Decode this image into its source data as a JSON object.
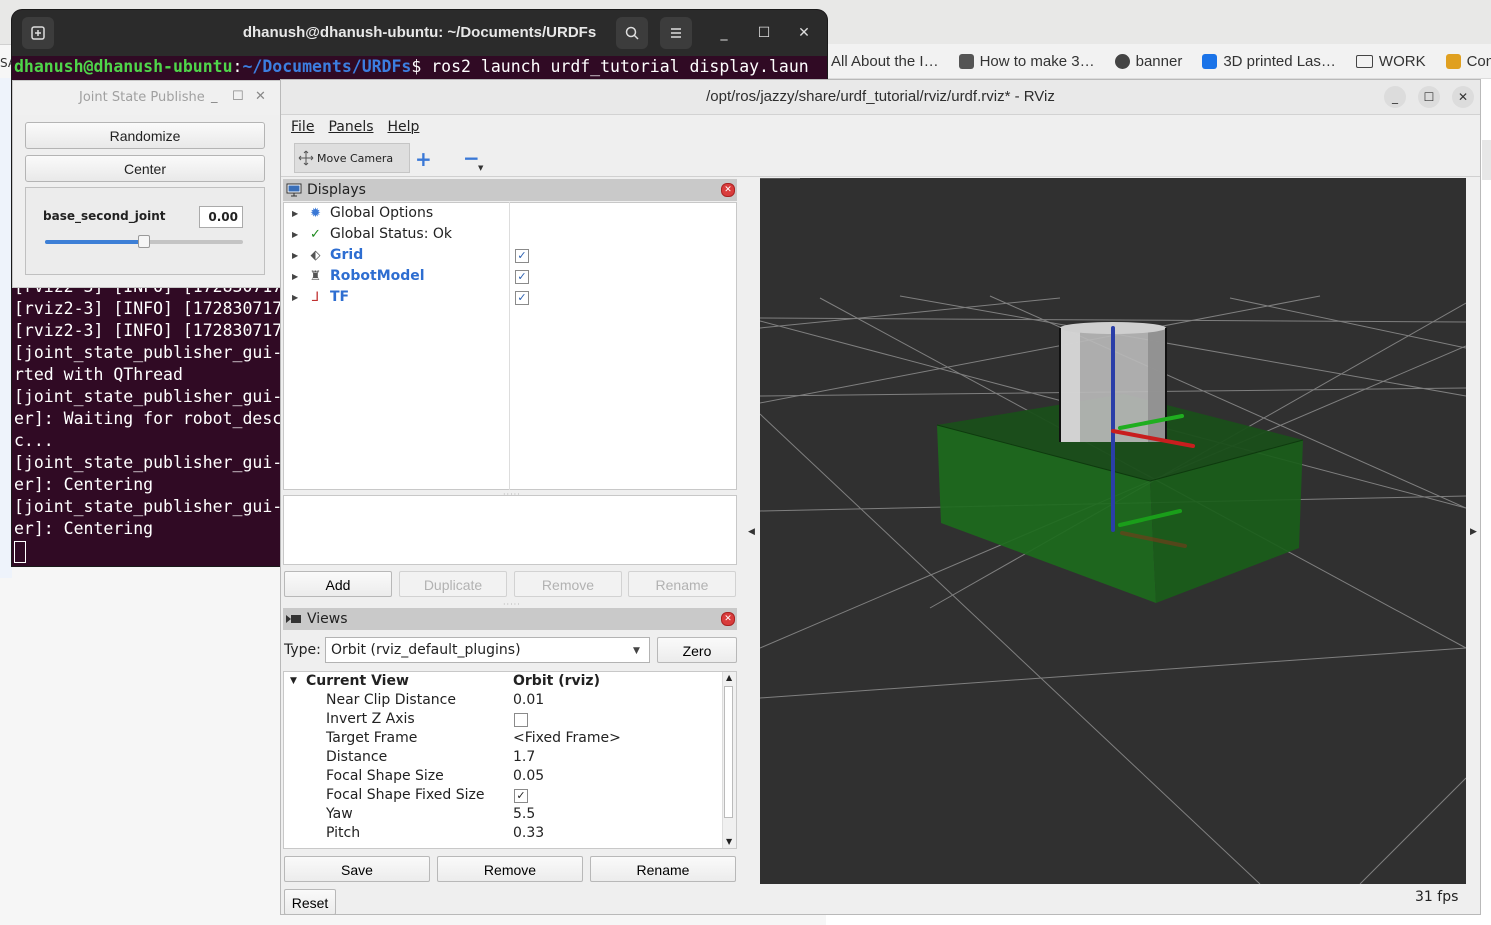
{
  "browser": {
    "bookmarks": [
      {
        "label": "All About the I…",
        "icon": "none",
        "color": ""
      },
      {
        "label": "How to make 3…",
        "icon": "site-icon",
        "color": "#555555"
      },
      {
        "label": "banner",
        "icon": "globe-icon",
        "color": "#444444"
      },
      {
        "label": "3D printed Las…",
        "icon": "site-icon",
        "color": "#1a73e8"
      },
      {
        "label": "WORK",
        "icon": "folder-icon",
        "color": "#444444"
      },
      {
        "label": "Con",
        "icon": "site-icon",
        "color": "#e0a020"
      }
    ],
    "left_edge_text": "SA"
  },
  "terminal": {
    "title": "dhanush@dhanush-ubuntu: ~/Documents/URDFs",
    "prompt_user": "dhanush@dhanush-ubuntu",
    "prompt_sep": ":",
    "prompt_path": "~/Documents/URDFs",
    "command": "$ ros2 launch urdf_tutorial display.laun",
    "lines": [
      "[rviz2-3] [INFO] [172830717",
      "[rviz2-3] [INFO] [172830717",
      "[rviz2-3] [INFO] [172830717",
      "[joint_state_publisher_gui-",
      "rted with QThread",
      "[joint_state_publisher_gui-",
      "er]: Waiting for robot_desc",
      "c...",
      "[joint_state_publisher_gui-",
      "er]: Centering",
      "[joint_state_publisher_gui-",
      "er]: Centering"
    ]
  },
  "jsp": {
    "title": "Joint State Publishe",
    "randomize": "Randomize",
    "center": "Center",
    "joint_name": "base_second_joint",
    "joint_value": "0.00",
    "slider_fraction": 0.5
  },
  "rviz": {
    "title": "/opt/ros/jazzy/share/urdf_tutorial/rviz/urdf.rviz* - RViz",
    "menu": [
      "File",
      "Panels",
      "Help"
    ],
    "tool_move_camera": "Move Camera",
    "displays": {
      "header": "Displays",
      "items": [
        {
          "label": "Global Options",
          "icon": "gear-icon",
          "checked": null,
          "highlight": false
        },
        {
          "label": "Global Status: Ok",
          "icon": "checkmark-icon",
          "checked": null,
          "highlight": false
        },
        {
          "label": "Grid",
          "icon": "grid-icon",
          "checked": true,
          "highlight": true
        },
        {
          "label": "RobotModel",
          "icon": "robot-icon",
          "checked": true,
          "highlight": true
        },
        {
          "label": "TF",
          "icon": "axes-icon",
          "checked": true,
          "highlight": true
        }
      ],
      "buttons": {
        "add": "Add",
        "duplicate": "Duplicate",
        "remove": "Remove",
        "rename": "Rename"
      }
    },
    "views": {
      "header": "Views",
      "type_label": "Type:",
      "type_value": "Orbit (rviz_default_plugins)",
      "zero": "Zero",
      "current_view_label": "Current View",
      "current_view_value": "Orbit (rviz)",
      "properties": [
        {
          "name": "Near Clip Distance",
          "value": "0.01",
          "checkbox": false
        },
        {
          "name": "Invert Z Axis",
          "value": "",
          "checkbox": true,
          "checked": false
        },
        {
          "name": "Target Frame",
          "value": "<Fixed Frame>",
          "checkbox": false
        },
        {
          "name": "Distance",
          "value": "1.7",
          "checkbox": false
        },
        {
          "name": "Focal Shape Size",
          "value": "0.05",
          "checkbox": false
        },
        {
          "name": "Focal Shape Fixed Size",
          "value": "",
          "checkbox": true,
          "checked": true
        },
        {
          "name": "Yaw",
          "value": "5.5",
          "checkbox": false
        },
        {
          "name": "Pitch",
          "value": "0.33",
          "checkbox": false
        }
      ],
      "buttons": {
        "save": "Save",
        "remove": "Remove",
        "rename": "Rename"
      }
    },
    "reset": "Reset",
    "fps": "31 fps",
    "colors": {
      "base_box": "#1f6e1f",
      "cylinder": "#bdbdbd",
      "viewport_bg": "#303030",
      "grid": "#a0a0a0"
    }
  }
}
